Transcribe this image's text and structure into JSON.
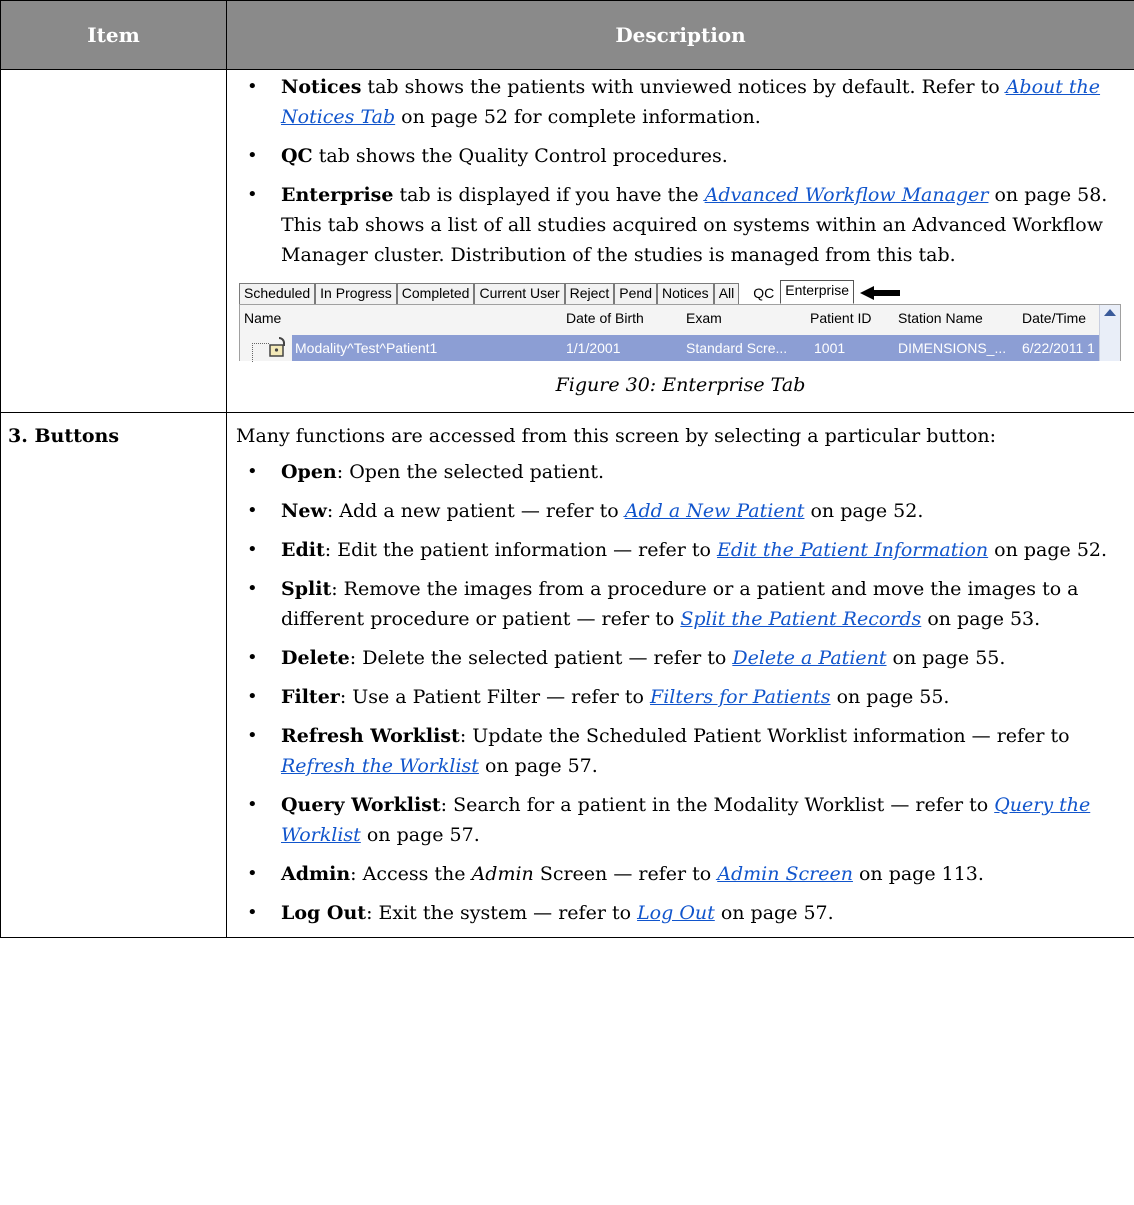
{
  "header": {
    "item": "Item",
    "description": "Description"
  },
  "row1": {
    "b1": {
      "bold": "Notices",
      "t1": " tab shows the patients with unviewed notices by default. Refer to ",
      "link": "About the Notices Tab",
      "t2": " on page 52 for complete information."
    },
    "b2": {
      "bold": "QC",
      "t1": " tab shows the Quality Control procedures."
    },
    "b3": {
      "bold": "Enterprise",
      "t1": " tab is displayed if you have the ",
      "link": "Advanced Workflow Manager",
      "t2": " on page 58. This tab shows a list of all studies acquired on systems within an Advanced Workflow Manager cluster. Distribution of the studies is managed from this tab."
    },
    "screenshot": {
      "tabs": [
        "Scheduled",
        "In Progress",
        "Completed",
        "Current User",
        "Reject",
        "Pend",
        "Notices",
        "All",
        "QC",
        "Enterprise"
      ],
      "columns": [
        "Name",
        "Date of Birth",
        "Exam",
        "Patient ID",
        "Station Name",
        "Date/Time"
      ],
      "row": [
        "Modality^Test^Patient1",
        "1/1/2001",
        "Standard Scre...",
        "1001",
        "DIMENSIONS_...",
        "6/22/2011 1"
      ],
      "lock_icon": "padlock-icon",
      "arrow_icon": "left-arrow-icon"
    },
    "caption": "Figure 30: Enterprise Tab"
  },
  "row2": {
    "item": "3. Buttons",
    "intro": "Many functions are accessed from this screen by selecting a particular button:",
    "bullets": [
      {
        "bold": "Open",
        "t1": ": Open the selected patient.",
        "link": "",
        "t2": ""
      },
      {
        "bold": "New",
        "t1": ": Add a new patient — refer to ",
        "link": "Add a New Patient",
        "t2": " on page 52."
      },
      {
        "bold": "Edit",
        "t1": ": Edit the patient information — refer to ",
        "link": "Edit the Patient Information",
        "t2": " on page 52."
      },
      {
        "bold": "Split",
        "t1": ": Remove the images from a procedure or a patient and move the images to a different procedure or patient — refer to ",
        "link": "Split the Patient Records",
        "t2": " on page 53."
      },
      {
        "bold": "Delete",
        "t1": ": Delete the selected patient — refer to ",
        "link": "Delete a Patient",
        "t2": " on page 55."
      },
      {
        "bold": "Filter",
        "t1": ": Use a Patient Filter — refer to ",
        "link": "Filters for Patients",
        "t2": " on page 55."
      },
      {
        "bold": "Refresh Worklist",
        "t1": ": Update the Scheduled Patient Worklist information — refer to ",
        "link": "Refresh the Worklist",
        "t2": " on page 57."
      },
      {
        "bold": "Query Worklist",
        "t1": ": Search for a patient in the Modality Worklist — refer to ",
        "link": "Query the Worklist",
        "t2": " on page 57."
      },
      {
        "bold": "Log Out",
        "t1": ": Exit the system — refer to ",
        "link": "Log Out",
        "t2": " on page 57."
      }
    ],
    "admin": {
      "bold": "Admin",
      "t1": ": Access the ",
      "ital": "Admin",
      "t2": " Screen — refer to ",
      "link": "Admin Screen",
      "t3": " on page 113."
    }
  }
}
